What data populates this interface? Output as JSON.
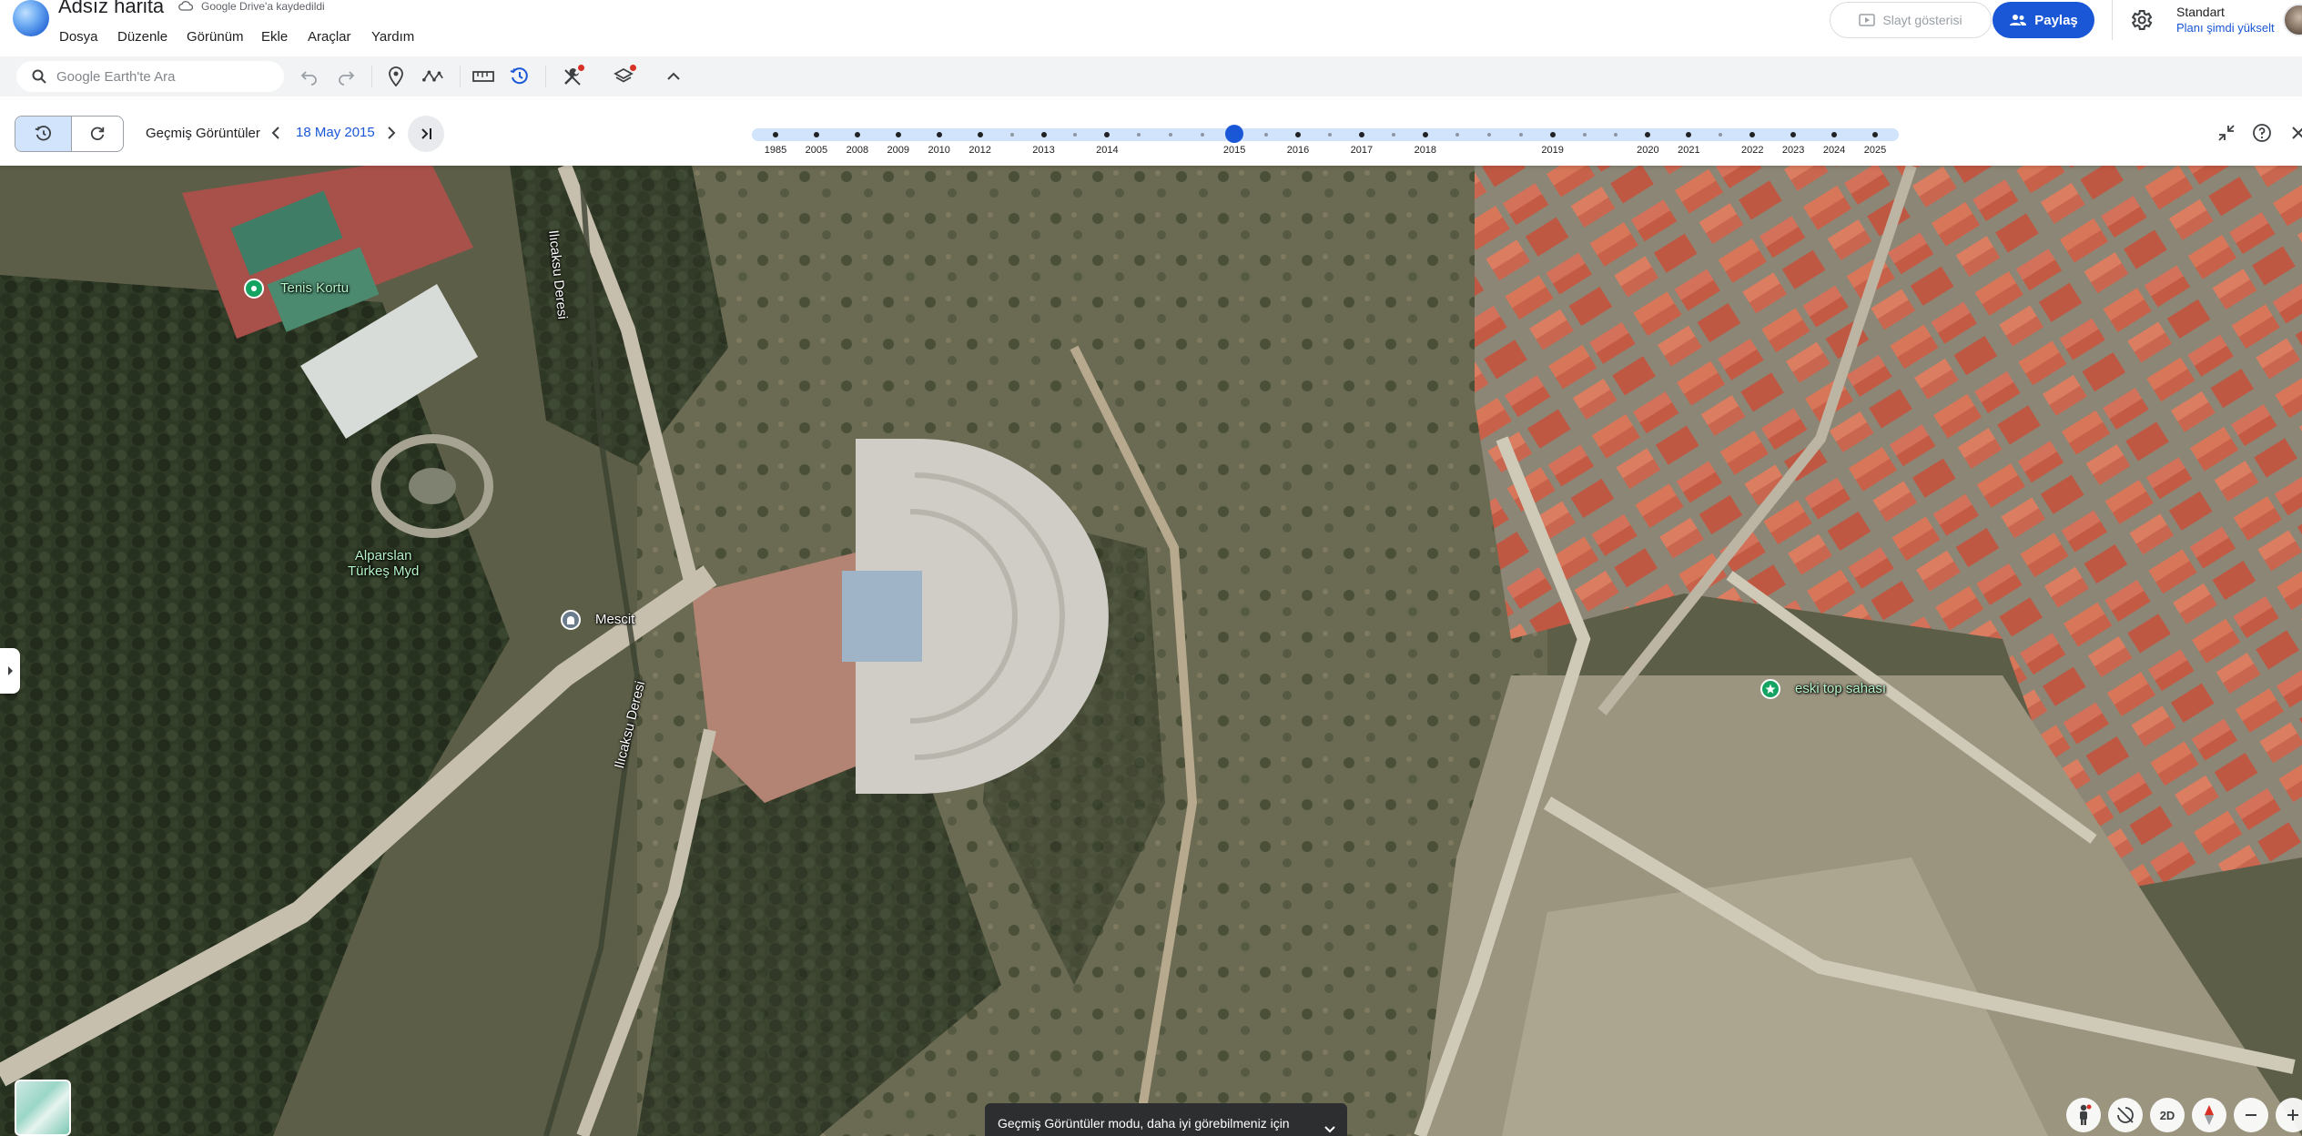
{
  "app": {
    "doc_title": "Adsız harita",
    "drive_status": "Google Drive'a kaydedildi",
    "menus": [
      "Dosya",
      "Düzenle",
      "Görünüm",
      "Ekle",
      "Araçlar",
      "Yardım"
    ],
    "slideshow_label": "Slayt gösterisi",
    "share_label": "Paylaş",
    "plan_name": "Standart",
    "plan_upgrade": "Planı şimdi yükselt"
  },
  "toolbar": {
    "search_placeholder": "Google Earth'te Ara",
    "icons": [
      "search-icon",
      "undo-icon",
      "redo-icon",
      "add-placemark-icon",
      "draw-path-icon",
      "ruler-icon",
      "historical-imagery-icon",
      "tools-icon",
      "layers-icon",
      "collapse-icon"
    ]
  },
  "history": {
    "label": "Geçmiş Görüntüler",
    "current_date": "18 May 2015",
    "years": [
      "1985",
      "2005",
      "2008",
      "2009",
      "2010",
      "2012",
      "2013",
      "2014",
      "2015",
      "2016",
      "2017",
      "2018",
      "2019",
      "2020",
      "2021",
      "2022",
      "2023",
      "2024",
      "2025"
    ],
    "selected_year": "2015"
  },
  "map": {
    "places": [
      {
        "name": "Tenis Kortu",
        "type": "green-pin"
      },
      {
        "name": "Alparslan\nTürkeş Myd",
        "type": "park-label"
      },
      {
        "name": "Mescit",
        "type": "mosque-pin"
      },
      {
        "name": "eski top sahası",
        "type": "green-pin"
      },
      {
        "name": "Ilıcaksu Deresi",
        "type": "stream"
      },
      {
        "name": "Ilıcaksu Deresi",
        "type": "stream"
      }
    ],
    "toast": "Geçmiş Görüntüler modu, daha iyi görebilmeniz için",
    "view_mode": "2D"
  },
  "colors": {
    "accent": "#1a57d6",
    "timeline_track": "#d2e3fc",
    "roof": "#c8614a"
  }
}
